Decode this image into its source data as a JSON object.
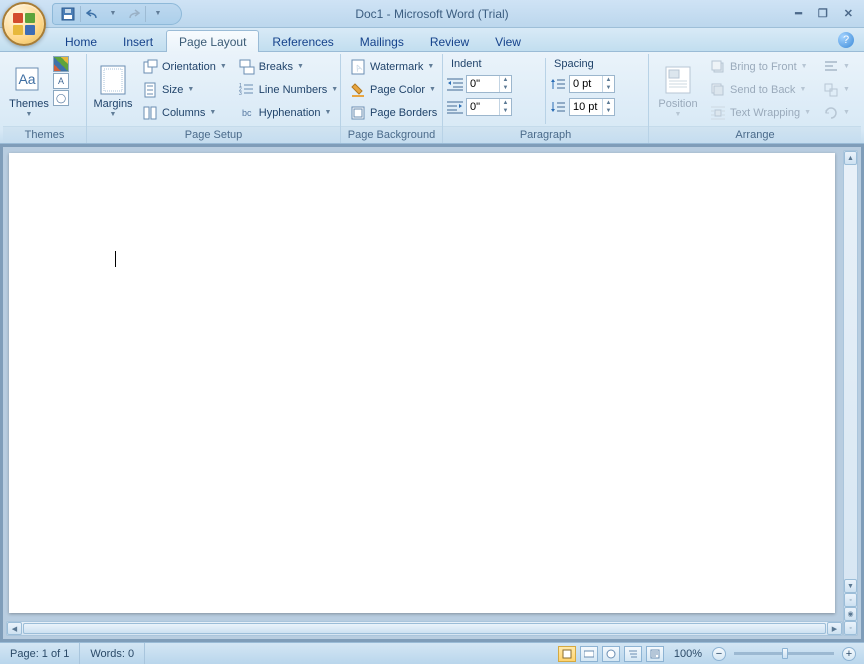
{
  "title": "Doc1 - Microsoft Word (Trial)",
  "tabs": {
    "home": "Home",
    "insert": "Insert",
    "pagelayout": "Page Layout",
    "references": "References",
    "mailings": "Mailings",
    "review": "Review",
    "view": "View"
  },
  "themes": {
    "group": "Themes",
    "themes": "Themes"
  },
  "pagesetup": {
    "group": "Page Setup",
    "margins": "Margins",
    "orientation": "Orientation",
    "size": "Size",
    "columns": "Columns",
    "breaks": "Breaks",
    "linenumbers": "Line Numbers",
    "hyphenation": "Hyphenation"
  },
  "pagebg": {
    "group": "Page Background",
    "watermark": "Watermark",
    "pagecolor": "Page Color",
    "pageborders": "Page Borders"
  },
  "para": {
    "group": "Paragraph",
    "indent": "Indent",
    "spacing": "Spacing",
    "indent_left": "0\"",
    "indent_right": "0\"",
    "space_before": "0 pt",
    "space_after": "10 pt"
  },
  "arrange": {
    "group": "Arrange",
    "position": "Position",
    "bringfront": "Bring to Front",
    "sendback": "Send to Back",
    "textwrap": "Text Wrapping"
  },
  "status": {
    "page": "Page: 1 of 1",
    "words": "Words: 0",
    "zoom": "100%"
  }
}
